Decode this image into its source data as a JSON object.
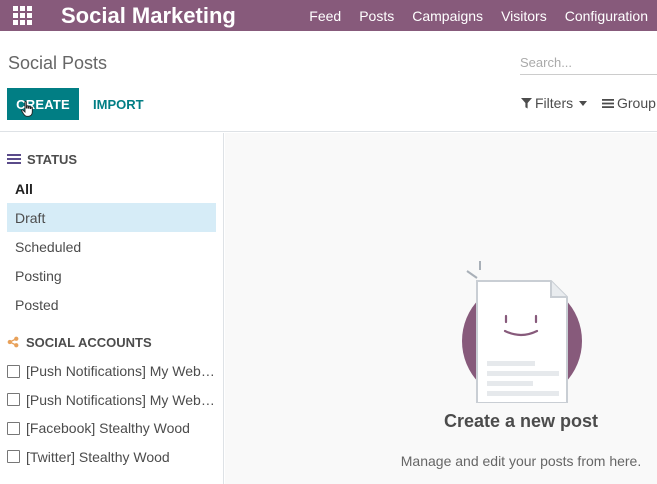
{
  "navbar": {
    "app_title": "Social Marketing",
    "menu": [
      "Feed",
      "Posts",
      "Campaigns",
      "Visitors",
      "Configuration"
    ]
  },
  "control_panel": {
    "breadcrumb": "Social Posts",
    "search_placeholder": "Search...",
    "create_label": "CREATE",
    "import_label": "IMPORT",
    "filters_label": "Filters",
    "group_label": "Group"
  },
  "sidebar": {
    "status_header": "STATUS",
    "status_items": [
      "All",
      "Draft",
      "Scheduled",
      "Posting",
      "Posted"
    ],
    "selected_status": "Draft",
    "accounts_header": "SOCIAL ACCOUNTS",
    "accounts": [
      "[Push Notifications] My Website",
      "[Push Notifications] My Website",
      "[Facebook] Stealthy Wood",
      "[Twitter] Stealthy Wood"
    ]
  },
  "help": {
    "title": "Create a new post",
    "subtitle": "Manage and edit your posts from here."
  },
  "colors": {
    "navbar": "#875A7B",
    "primary_button": "#017e84",
    "selected_row": "#d6ecf7",
    "status_icon": "#5a4b8a",
    "accounts_icon": "#e8a15a"
  },
  "icons": [
    "apps-grid-icon",
    "filter-icon",
    "group-by-icon",
    "caret-down-icon",
    "status-list-icon",
    "share-icon",
    "hand-cursor-icon"
  ]
}
